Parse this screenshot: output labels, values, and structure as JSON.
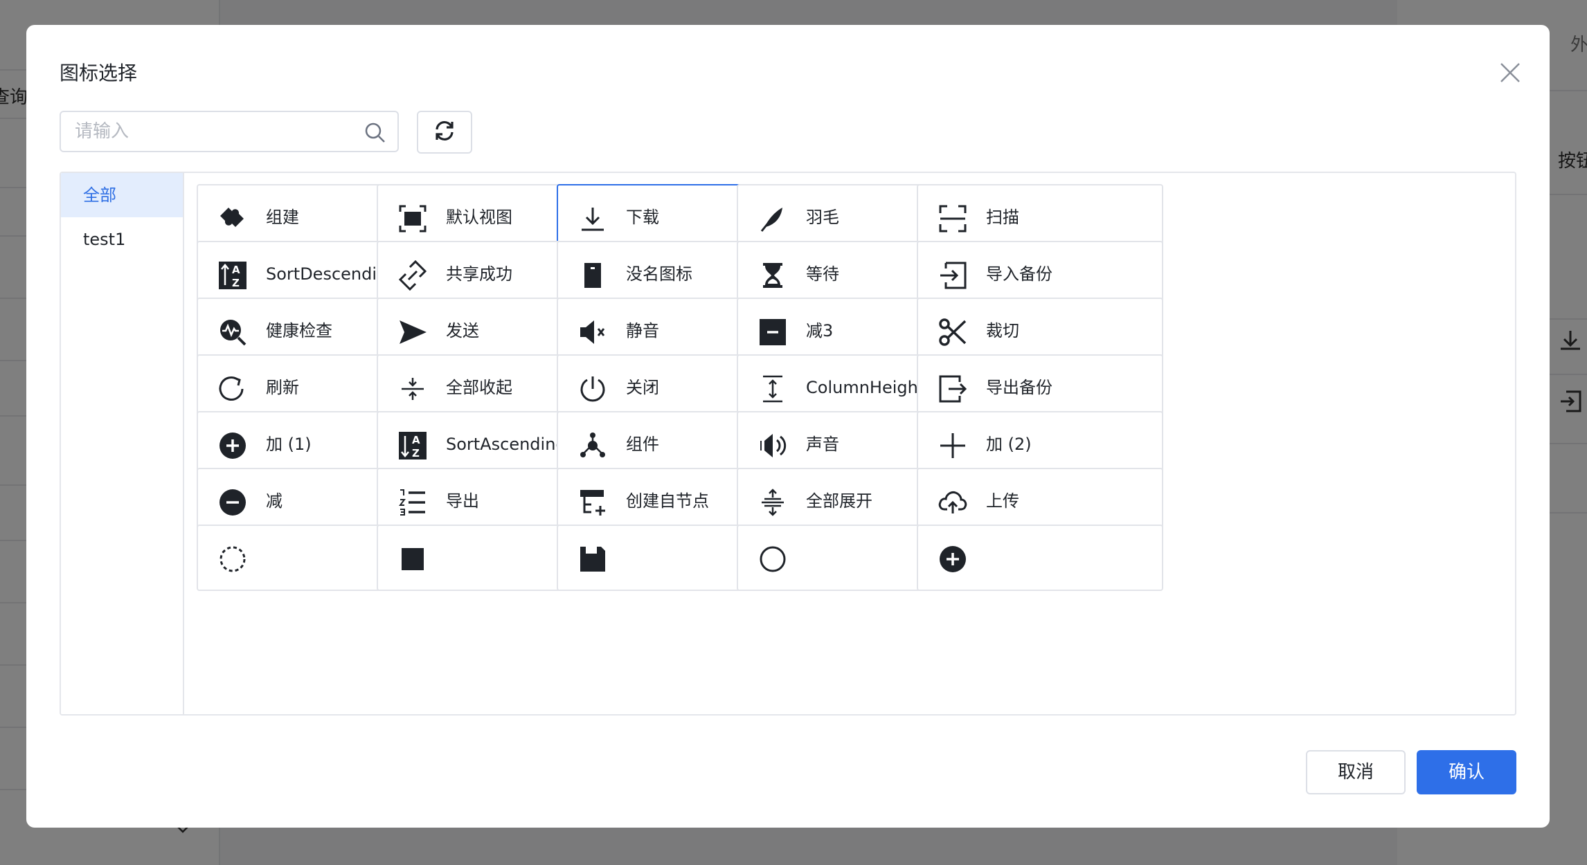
{
  "background": {
    "left_text": "查询",
    "right_top_text": "外",
    "right_button_text": "按钮",
    "chevron_icon": "chevron-down-icon"
  },
  "modal": {
    "title": "图标选择",
    "close_icon": "close-icon",
    "search": {
      "placeholder": "请输入",
      "value": "",
      "icon": "search-icon"
    },
    "refresh_icon": "refresh-icon",
    "categories": [
      {
        "label": "全部",
        "active": true
      },
      {
        "label": "test1",
        "active": false
      }
    ],
    "icons": [
      {
        "label": "组建",
        "icon": "puzzle-icon"
      },
      {
        "label": "默认视图",
        "icon": "fullscreen-view-icon"
      },
      {
        "label": "下载",
        "icon": "download-icon",
        "selected": true
      },
      {
        "label": "羽毛",
        "icon": "feather-icon"
      },
      {
        "label": "扫描",
        "icon": "scan-icon"
      },
      {
        "label": "SortDescending",
        "icon": "sort-descending-icon"
      },
      {
        "label": "共享成功",
        "icon": "share-link-icon"
      },
      {
        "label": "没名图标",
        "icon": "door-icon"
      },
      {
        "label": "等待",
        "icon": "hourglass-icon"
      },
      {
        "label": "导入备份",
        "icon": "import-icon"
      },
      {
        "label": "健康检查",
        "icon": "health-check-icon"
      },
      {
        "label": "发送",
        "icon": "send-icon"
      },
      {
        "label": "静音",
        "icon": "mute-icon"
      },
      {
        "label": "减3",
        "icon": "minus-square-icon"
      },
      {
        "label": "裁切",
        "icon": "scissor-icon"
      },
      {
        "label": "刷新",
        "icon": "reload-icon"
      },
      {
        "label": "全部收起",
        "icon": "collapse-all-icon"
      },
      {
        "label": "关闭",
        "icon": "power-icon"
      },
      {
        "label": "ColumnHeight",
        "icon": "column-height-icon"
      },
      {
        "label": "导出备份",
        "icon": "export-icon"
      },
      {
        "label": "加 (1)",
        "icon": "plus-circle-icon"
      },
      {
        "label": "SortAscending",
        "icon": "sort-ascending-icon"
      },
      {
        "label": "组件",
        "icon": "cluster-icon"
      },
      {
        "label": "声音",
        "icon": "sound-icon"
      },
      {
        "label": "加 (2)",
        "icon": "plus-icon"
      },
      {
        "label": "减",
        "icon": "minus-circle-icon"
      },
      {
        "label": "导出",
        "icon": "ordered-list-icon"
      },
      {
        "label": "创建自节点",
        "icon": "add-child-node-icon"
      },
      {
        "label": "全部展开",
        "icon": "expand-all-icon"
      },
      {
        "label": "上传",
        "icon": "cloud-upload-icon"
      },
      {
        "label": "",
        "icon": "dashed-circle-icon"
      },
      {
        "label": "",
        "icon": "square-icon"
      },
      {
        "label": "",
        "icon": "save-icon"
      },
      {
        "label": "",
        "icon": "circle-icon"
      },
      {
        "label": "",
        "icon": "zoom-in-icon"
      }
    ],
    "buttons": {
      "cancel": "取消",
      "confirm": "确认"
    },
    "colors": {
      "primary": "#2e6fe8",
      "active_bg": "#e3edfd",
      "icon": "#1f2329"
    }
  }
}
